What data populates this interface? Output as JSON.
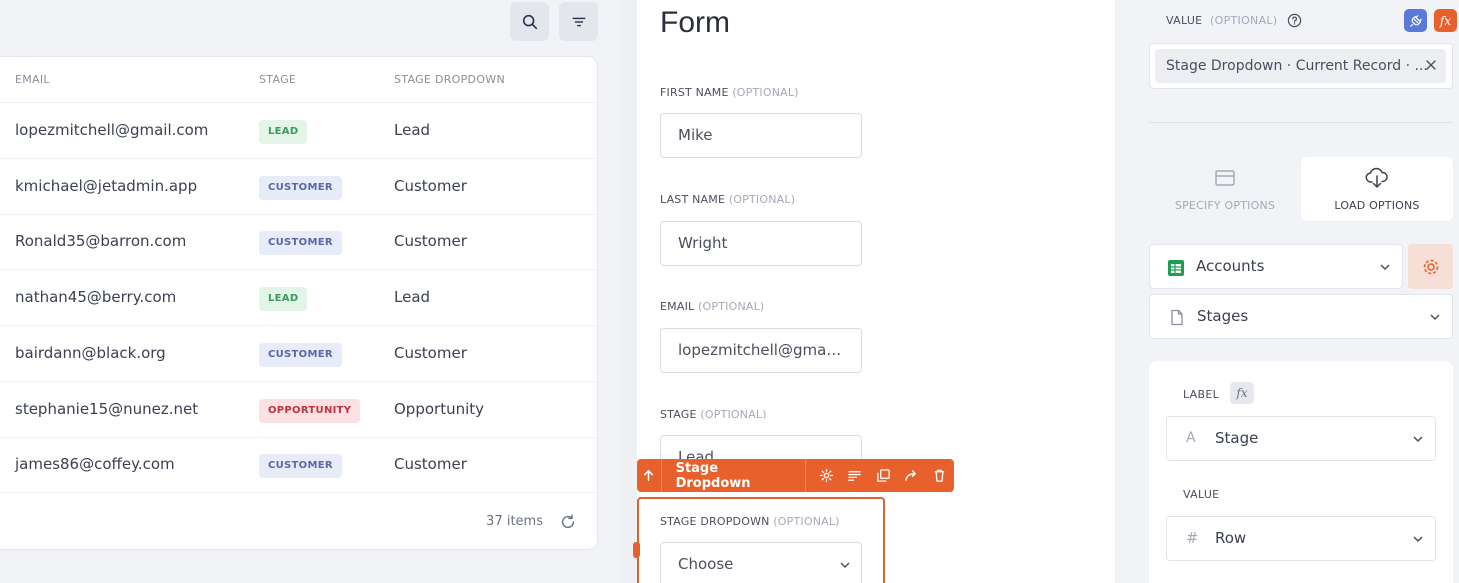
{
  "table": {
    "columns": [
      "EMAIL",
      "STAGE",
      "STAGE DROPDOWN"
    ],
    "rows": [
      {
        "email": "lopezmitchell@gmail.com",
        "stage": "LEAD",
        "stage_kind": "lead",
        "dropdown": "Lead"
      },
      {
        "email": "kmichael@jetadmin.app",
        "stage": "CUSTOMER",
        "stage_kind": "customer",
        "dropdown": "Customer"
      },
      {
        "email": "Ronald35@barron.com",
        "stage": "CUSTOMER",
        "stage_kind": "customer",
        "dropdown": "Customer"
      },
      {
        "email": "nathan45@berry.com",
        "stage": "LEAD",
        "stage_kind": "lead",
        "dropdown": "Lead"
      },
      {
        "email": "bairdann@black.org",
        "stage": "CUSTOMER",
        "stage_kind": "customer",
        "dropdown": "Customer"
      },
      {
        "email": "stephanie15@nunez.net",
        "stage": "OPPORTUNITY",
        "stage_kind": "opportunity",
        "dropdown": "Opportunity"
      },
      {
        "email": "james86@coffey.com",
        "stage": "CUSTOMER",
        "stage_kind": "customer",
        "dropdown": "Customer"
      }
    ],
    "items_count": "37 items"
  },
  "form": {
    "title": "Form",
    "optional": "(OPTIONAL)",
    "fields": {
      "first_name": {
        "label": "FIRST NAME",
        "value": "Mike"
      },
      "last_name": {
        "label": "LAST NAME",
        "value": "Wright"
      },
      "email": {
        "label": "EMAIL",
        "value": "lopezmitchell@gmail..."
      },
      "stage": {
        "label": "STAGE",
        "value": "Lead"
      },
      "stage_dropdown": {
        "label": "STAGE DROPDOWN",
        "value": "Choose"
      }
    },
    "toolbar": {
      "title": "Stage Dropdown"
    }
  },
  "panel": {
    "value_label": "VALUE",
    "optional": "(OPTIONAL)",
    "fx_label": "fx",
    "chip_text": "Stage Dropdown · Current Record · ...",
    "tabs": {
      "specify": "SPECIFY OPTIONS",
      "load": "LOAD OPTIONS"
    },
    "resource": "Accounts",
    "collection": "Stages",
    "label_label": "LABEL",
    "label_value": "Stage",
    "value_field_label": "VALUE",
    "value_field_value": "Row"
  },
  "colors": {
    "accent": "#e8612d",
    "lead": "#3a9a5a",
    "customer": "#5868a8",
    "opportunity": "#c0323e"
  }
}
